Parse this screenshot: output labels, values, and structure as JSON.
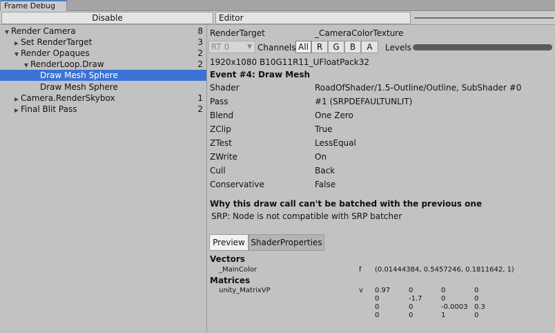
{
  "window": {
    "tab_title": "Frame Debug"
  },
  "toolbar": {
    "disable_label": "Disable",
    "target_label": "Editor"
  },
  "tree": [
    {
      "label": "Render Camera",
      "count": "8",
      "expanded": true,
      "arrow": "▼"
    },
    {
      "label": "Set RenderTarget",
      "count": "3",
      "expanded": false,
      "arrow": "▶"
    },
    {
      "label": "Render Opaques",
      "count": "2",
      "expanded": true,
      "arrow": "▼"
    },
    {
      "label": "RenderLoop.Draw",
      "count": "2",
      "expanded": true,
      "arrow": "▼"
    },
    {
      "label": "Draw Mesh Sphere",
      "count": "",
      "selected": true
    },
    {
      "label": "Draw Mesh Sphere",
      "count": ""
    },
    {
      "label": "Camera.RenderSkybox",
      "count": "1",
      "expanded": false,
      "arrow": "▶"
    },
    {
      "label": "Final Blit Pass",
      "count": "2",
      "expanded": false,
      "arrow": "▶"
    }
  ],
  "details": {
    "render_target_label": "RenderTarget",
    "render_target_value": "_CameraColorTexture",
    "rt_select": "RT 0",
    "channels_label": "Channels",
    "channels": [
      "All",
      "R",
      "G",
      "B",
      "A"
    ],
    "levels_label": "Levels",
    "resolution": "1920x1080 B10G11R11_UFloatPack32",
    "event_title": "Event #4: Draw Mesh",
    "properties": [
      {
        "key": "Shader",
        "value": "RoadOfShader/1.5-Outline/Outline, SubShader #0"
      },
      {
        "key": "Pass",
        "value": "#1 (SRPDEFAULTUNLIT)"
      },
      {
        "key": "Blend",
        "value": "One Zero"
      },
      {
        "key": "ZClip",
        "value": "True"
      },
      {
        "key": "ZTest",
        "value": "LessEqual"
      },
      {
        "key": "ZWrite",
        "value": "On"
      },
      {
        "key": "Cull",
        "value": "Back"
      },
      {
        "key": "Conservative",
        "value": "False"
      }
    ],
    "batch_title": "Why this draw call can't be batched with the previous one",
    "batch_reason": "SRP: Node is not compatible with SRP batcher",
    "tabs": [
      "Preview",
      "ShaderProperties"
    ],
    "vectors_title": "Vectors",
    "vector": {
      "name": "_MainColor",
      "type": "f",
      "value": "(0.01444384, 0.5457246, 0.1811642, 1)"
    },
    "matrices_title": "Matrices",
    "matrix": {
      "name": "unity_MatrixVP",
      "type": "v",
      "rows": [
        [
          "0.97",
          "0",
          "0",
          "0"
        ],
        [
          "0",
          "-1.7",
          "0",
          "0"
        ],
        [
          "0",
          "0",
          "-0.0003",
          "0.3"
        ],
        [
          "0",
          "0",
          "1",
          "0"
        ]
      ]
    }
  }
}
